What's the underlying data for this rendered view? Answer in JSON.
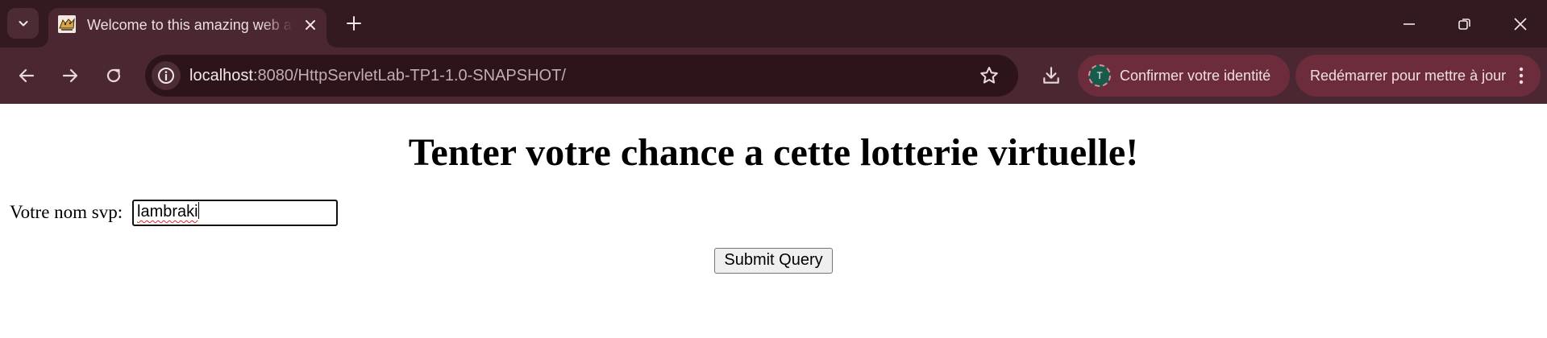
{
  "browser": {
    "tab": {
      "title": "Welcome to this amazing web application"
    },
    "address_bar": {
      "url_host": "localhost",
      "url_path": ":8080/HttpServletLab-TP1-1.0-SNAPSHOT/"
    },
    "profile": {
      "avatar_letter": "T",
      "label": "Confirmer votre identité"
    },
    "update": {
      "label": "Redémarrer pour mettre à jour"
    },
    "icons": {
      "tab_search": "chevron-down-icon",
      "favicon": "tomcat-icon",
      "tab_close": "close-icon",
      "new_tab": "plus-icon",
      "minimize": "minimize-icon",
      "restore": "restore-icon",
      "close_window": "close-icon",
      "back": "arrow-left-icon",
      "forward": "arrow-right-icon",
      "reload": "reload-icon",
      "site_info": "info-icon",
      "bookmark": "star-icon",
      "downloads": "download-icon",
      "menu": "more-vertical-icon"
    },
    "colors": {
      "frame": "#331a20",
      "toolbar": "#4b2731",
      "omnibox": "#2c1419",
      "chip": "#6c2c3c"
    }
  },
  "page": {
    "heading": "Tenter votre chance a cette lotterie virtuelle!",
    "form": {
      "name_label": "Votre nom svp:",
      "name_value": "lambraki",
      "submit_label": "Submit Query"
    }
  }
}
